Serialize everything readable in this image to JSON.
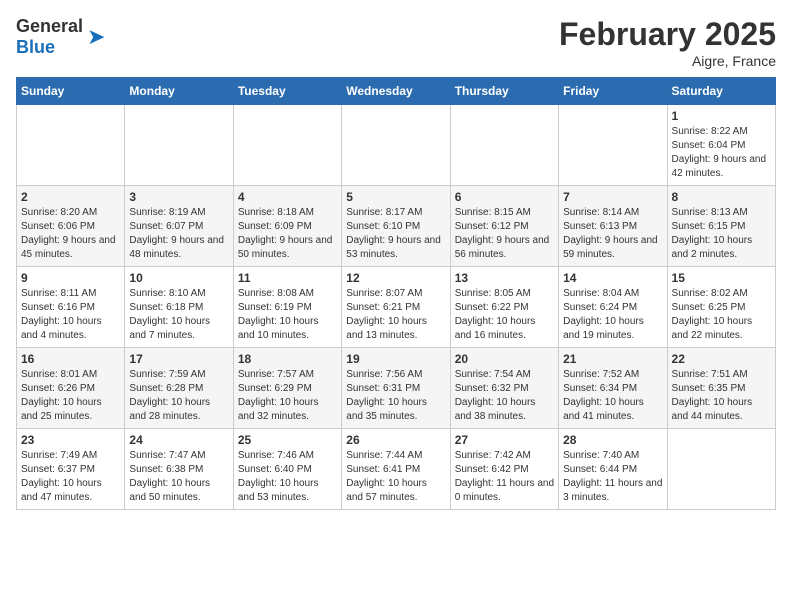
{
  "header": {
    "logo_general": "General",
    "logo_blue": "Blue",
    "title": "February 2025",
    "location": "Aigre, France"
  },
  "weekdays": [
    "Sunday",
    "Monday",
    "Tuesday",
    "Wednesday",
    "Thursday",
    "Friday",
    "Saturday"
  ],
  "weeks": [
    [
      {
        "day": "",
        "info": ""
      },
      {
        "day": "",
        "info": ""
      },
      {
        "day": "",
        "info": ""
      },
      {
        "day": "",
        "info": ""
      },
      {
        "day": "",
        "info": ""
      },
      {
        "day": "",
        "info": ""
      },
      {
        "day": "1",
        "info": "Sunrise: 8:22 AM\nSunset: 6:04 PM\nDaylight: 9 hours and 42 minutes."
      }
    ],
    [
      {
        "day": "2",
        "info": "Sunrise: 8:20 AM\nSunset: 6:06 PM\nDaylight: 9 hours and 45 minutes."
      },
      {
        "day": "3",
        "info": "Sunrise: 8:19 AM\nSunset: 6:07 PM\nDaylight: 9 hours and 48 minutes."
      },
      {
        "day": "4",
        "info": "Sunrise: 8:18 AM\nSunset: 6:09 PM\nDaylight: 9 hours and 50 minutes."
      },
      {
        "day": "5",
        "info": "Sunrise: 8:17 AM\nSunset: 6:10 PM\nDaylight: 9 hours and 53 minutes."
      },
      {
        "day": "6",
        "info": "Sunrise: 8:15 AM\nSunset: 6:12 PM\nDaylight: 9 hours and 56 minutes."
      },
      {
        "day": "7",
        "info": "Sunrise: 8:14 AM\nSunset: 6:13 PM\nDaylight: 9 hours and 59 minutes."
      },
      {
        "day": "8",
        "info": "Sunrise: 8:13 AM\nSunset: 6:15 PM\nDaylight: 10 hours and 2 minutes."
      }
    ],
    [
      {
        "day": "9",
        "info": "Sunrise: 8:11 AM\nSunset: 6:16 PM\nDaylight: 10 hours and 4 minutes."
      },
      {
        "day": "10",
        "info": "Sunrise: 8:10 AM\nSunset: 6:18 PM\nDaylight: 10 hours and 7 minutes."
      },
      {
        "day": "11",
        "info": "Sunrise: 8:08 AM\nSunset: 6:19 PM\nDaylight: 10 hours and 10 minutes."
      },
      {
        "day": "12",
        "info": "Sunrise: 8:07 AM\nSunset: 6:21 PM\nDaylight: 10 hours and 13 minutes."
      },
      {
        "day": "13",
        "info": "Sunrise: 8:05 AM\nSunset: 6:22 PM\nDaylight: 10 hours and 16 minutes."
      },
      {
        "day": "14",
        "info": "Sunrise: 8:04 AM\nSunset: 6:24 PM\nDaylight: 10 hours and 19 minutes."
      },
      {
        "day": "15",
        "info": "Sunrise: 8:02 AM\nSunset: 6:25 PM\nDaylight: 10 hours and 22 minutes."
      }
    ],
    [
      {
        "day": "16",
        "info": "Sunrise: 8:01 AM\nSunset: 6:26 PM\nDaylight: 10 hours and 25 minutes."
      },
      {
        "day": "17",
        "info": "Sunrise: 7:59 AM\nSunset: 6:28 PM\nDaylight: 10 hours and 28 minutes."
      },
      {
        "day": "18",
        "info": "Sunrise: 7:57 AM\nSunset: 6:29 PM\nDaylight: 10 hours and 32 minutes."
      },
      {
        "day": "19",
        "info": "Sunrise: 7:56 AM\nSunset: 6:31 PM\nDaylight: 10 hours and 35 minutes."
      },
      {
        "day": "20",
        "info": "Sunrise: 7:54 AM\nSunset: 6:32 PM\nDaylight: 10 hours and 38 minutes."
      },
      {
        "day": "21",
        "info": "Sunrise: 7:52 AM\nSunset: 6:34 PM\nDaylight: 10 hours and 41 minutes."
      },
      {
        "day": "22",
        "info": "Sunrise: 7:51 AM\nSunset: 6:35 PM\nDaylight: 10 hours and 44 minutes."
      }
    ],
    [
      {
        "day": "23",
        "info": "Sunrise: 7:49 AM\nSunset: 6:37 PM\nDaylight: 10 hours and 47 minutes."
      },
      {
        "day": "24",
        "info": "Sunrise: 7:47 AM\nSunset: 6:38 PM\nDaylight: 10 hours and 50 minutes."
      },
      {
        "day": "25",
        "info": "Sunrise: 7:46 AM\nSunset: 6:40 PM\nDaylight: 10 hours and 53 minutes."
      },
      {
        "day": "26",
        "info": "Sunrise: 7:44 AM\nSunset: 6:41 PM\nDaylight: 10 hours and 57 minutes."
      },
      {
        "day": "27",
        "info": "Sunrise: 7:42 AM\nSunset: 6:42 PM\nDaylight: 11 hours and 0 minutes."
      },
      {
        "day": "28",
        "info": "Sunrise: 7:40 AM\nSunset: 6:44 PM\nDaylight: 11 hours and 3 minutes."
      },
      {
        "day": "",
        "info": ""
      }
    ]
  ]
}
